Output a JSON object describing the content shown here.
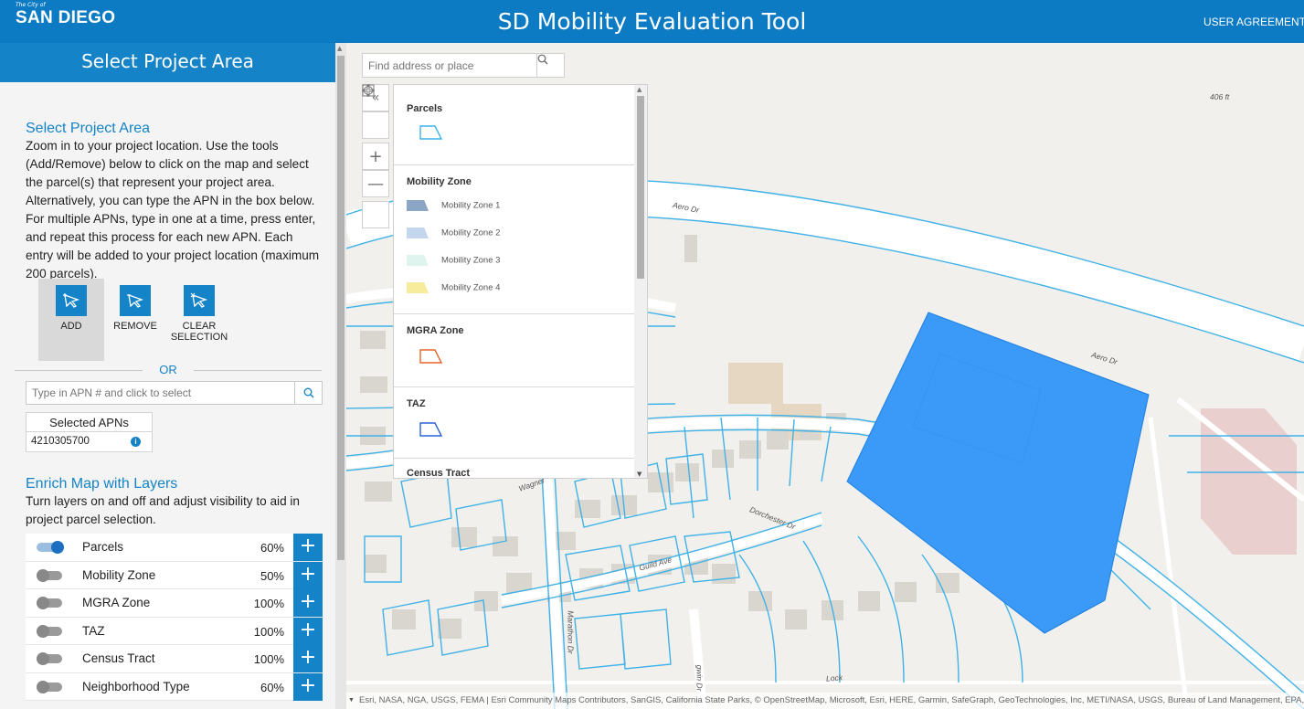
{
  "header": {
    "logo_small": "The City of",
    "logo_main": "SAN DIEGO",
    "title": "SD Mobility Evaluation Tool",
    "user_agreement": "USER AGREEMENT"
  },
  "panel": {
    "header_title": "Select Project Area",
    "section_title": "Select Project Area",
    "instructions": "Zoom in to your project location. Use the tools (Add/Remove) below to click on the map and select the parcel(s) that represent your project area. Alternatively, you can type the APN in the box below. For multiple APNs, type in one at a time, press enter, and repeat this process for each new APN. Each entry will be added to your project location (maximum 200 parcels).",
    "tools": [
      {
        "label": "ADD",
        "active": true
      },
      {
        "label": "REMOVE",
        "active": false
      },
      {
        "label": "CLEAR SELECTION",
        "active": false
      }
    ],
    "or_label": "OR",
    "apn_placeholder": "Type in APN # and click to select",
    "selected_apns_header": "Selected APNs",
    "selected_apns": [
      "4210305700"
    ],
    "enrich_title": "Enrich Map with Layers",
    "enrich_text": "Turn layers on and off and adjust visibility to aid in project parcel selection.",
    "layers": [
      {
        "name": "Parcels",
        "opacity": "60%",
        "on": true
      },
      {
        "name": "Mobility Zone",
        "opacity": "50%",
        "on": false
      },
      {
        "name": "MGRA Zone",
        "opacity": "100%",
        "on": false
      },
      {
        "name": "TAZ",
        "opacity": "100%",
        "on": false
      },
      {
        "name": "Census Tract",
        "opacity": "100%",
        "on": false
      },
      {
        "name": "Neighborhood Type",
        "opacity": "60%",
        "on": false
      }
    ]
  },
  "map": {
    "search_placeholder": "Find address or place",
    "legend": {
      "parcels_title": "Parcels",
      "mobility_title": "Mobility Zone",
      "mobility_items": [
        "Mobility Zone 1",
        "Mobility Zone 2",
        "Mobility Zone 3",
        "Mobility Zone 4"
      ],
      "mobility_colors": [
        "#8aa5c6",
        "#c3d6ee",
        "#dff4ee",
        "#f7ec9c"
      ],
      "mgra_title": "MGRA Zone",
      "taz_title": "TAZ",
      "census_title": "Census Tract"
    },
    "street_labels": {
      "aero_dr_1": "Aero Dr",
      "aero_dr_2": "Aero Dr",
      "dorchester": "Dorchester Dr",
      "guild": "Guild Ave",
      "wagner": "Wagner",
      "marathon": "Marathon Dr",
      "lock": "Lock",
      "gwin": "gwin Dr",
      "elevation": "406 ft"
    },
    "attribution": "Esri, NASA, NGA, USGS, FEMA | Esri Community Maps Contributors, SanGIS, California State Parks, © OpenStreetMap, Microsoft, Esri, HERE, Garmin, SafeGraph, GeoTechnologies, Inc, METI/NASA, USGS, Bureau of Land Management, EPA, NPS, US Census Bureau, USDA",
    "colors": {
      "parcel_line": "#3fb2e8",
      "selected_fill": "#3b9af7",
      "road": "#ffffff",
      "building": "#d7d3cc"
    }
  }
}
